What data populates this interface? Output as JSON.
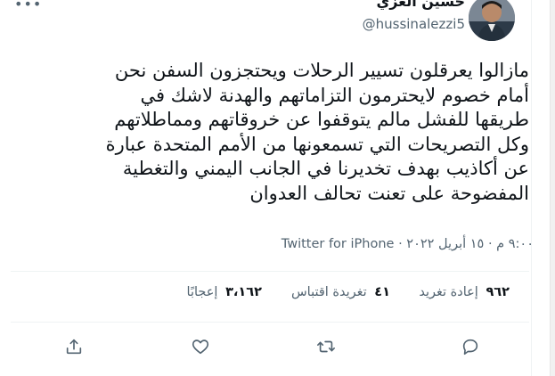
{
  "header": {
    "display_name": "حسين العزي",
    "handle": "@hussinalezzi5",
    "more_icon": "more-horizontal-icon"
  },
  "tweet": {
    "lines": [
      "مازالوا يعرقلون تسيير الرحلات ويحتجزون السفن نحن",
      "أمام خصوم لايحترمون التزاماتهم والهدنة لاشك في",
      "طريقها للفشل مالم يتوقفوا عن خروقاتهم ومماطلاتهم",
      "وكل التصريحات التي تسمعونها من الأمم المتحدة عبارة",
      "عن أكاذيب بهدف تخديرنا في الجانب اليمني والتغطية",
      "المفضوحة على تعنت تحالف العدوان"
    ]
  },
  "meta": {
    "time": "٩:٠٠ م",
    "separator": "·",
    "date": "١٥ أبريل ٢٠٢٢",
    "source": "Twitter for iPhone"
  },
  "stats": {
    "retweets_count": "٩٦٢",
    "retweets_label": "إعادة تغريد",
    "quotes_count": "٤١",
    "quotes_label": "تغريدة اقتباس",
    "likes_count": "٣،١٦٢",
    "likes_label": "إعجابًا"
  },
  "actions": [
    "reply-icon",
    "retweet-icon",
    "like-icon",
    "share-icon"
  ],
  "colors": {
    "text": "#0f1419",
    "secondary": "#536471",
    "divider": "#eff3f4"
  }
}
